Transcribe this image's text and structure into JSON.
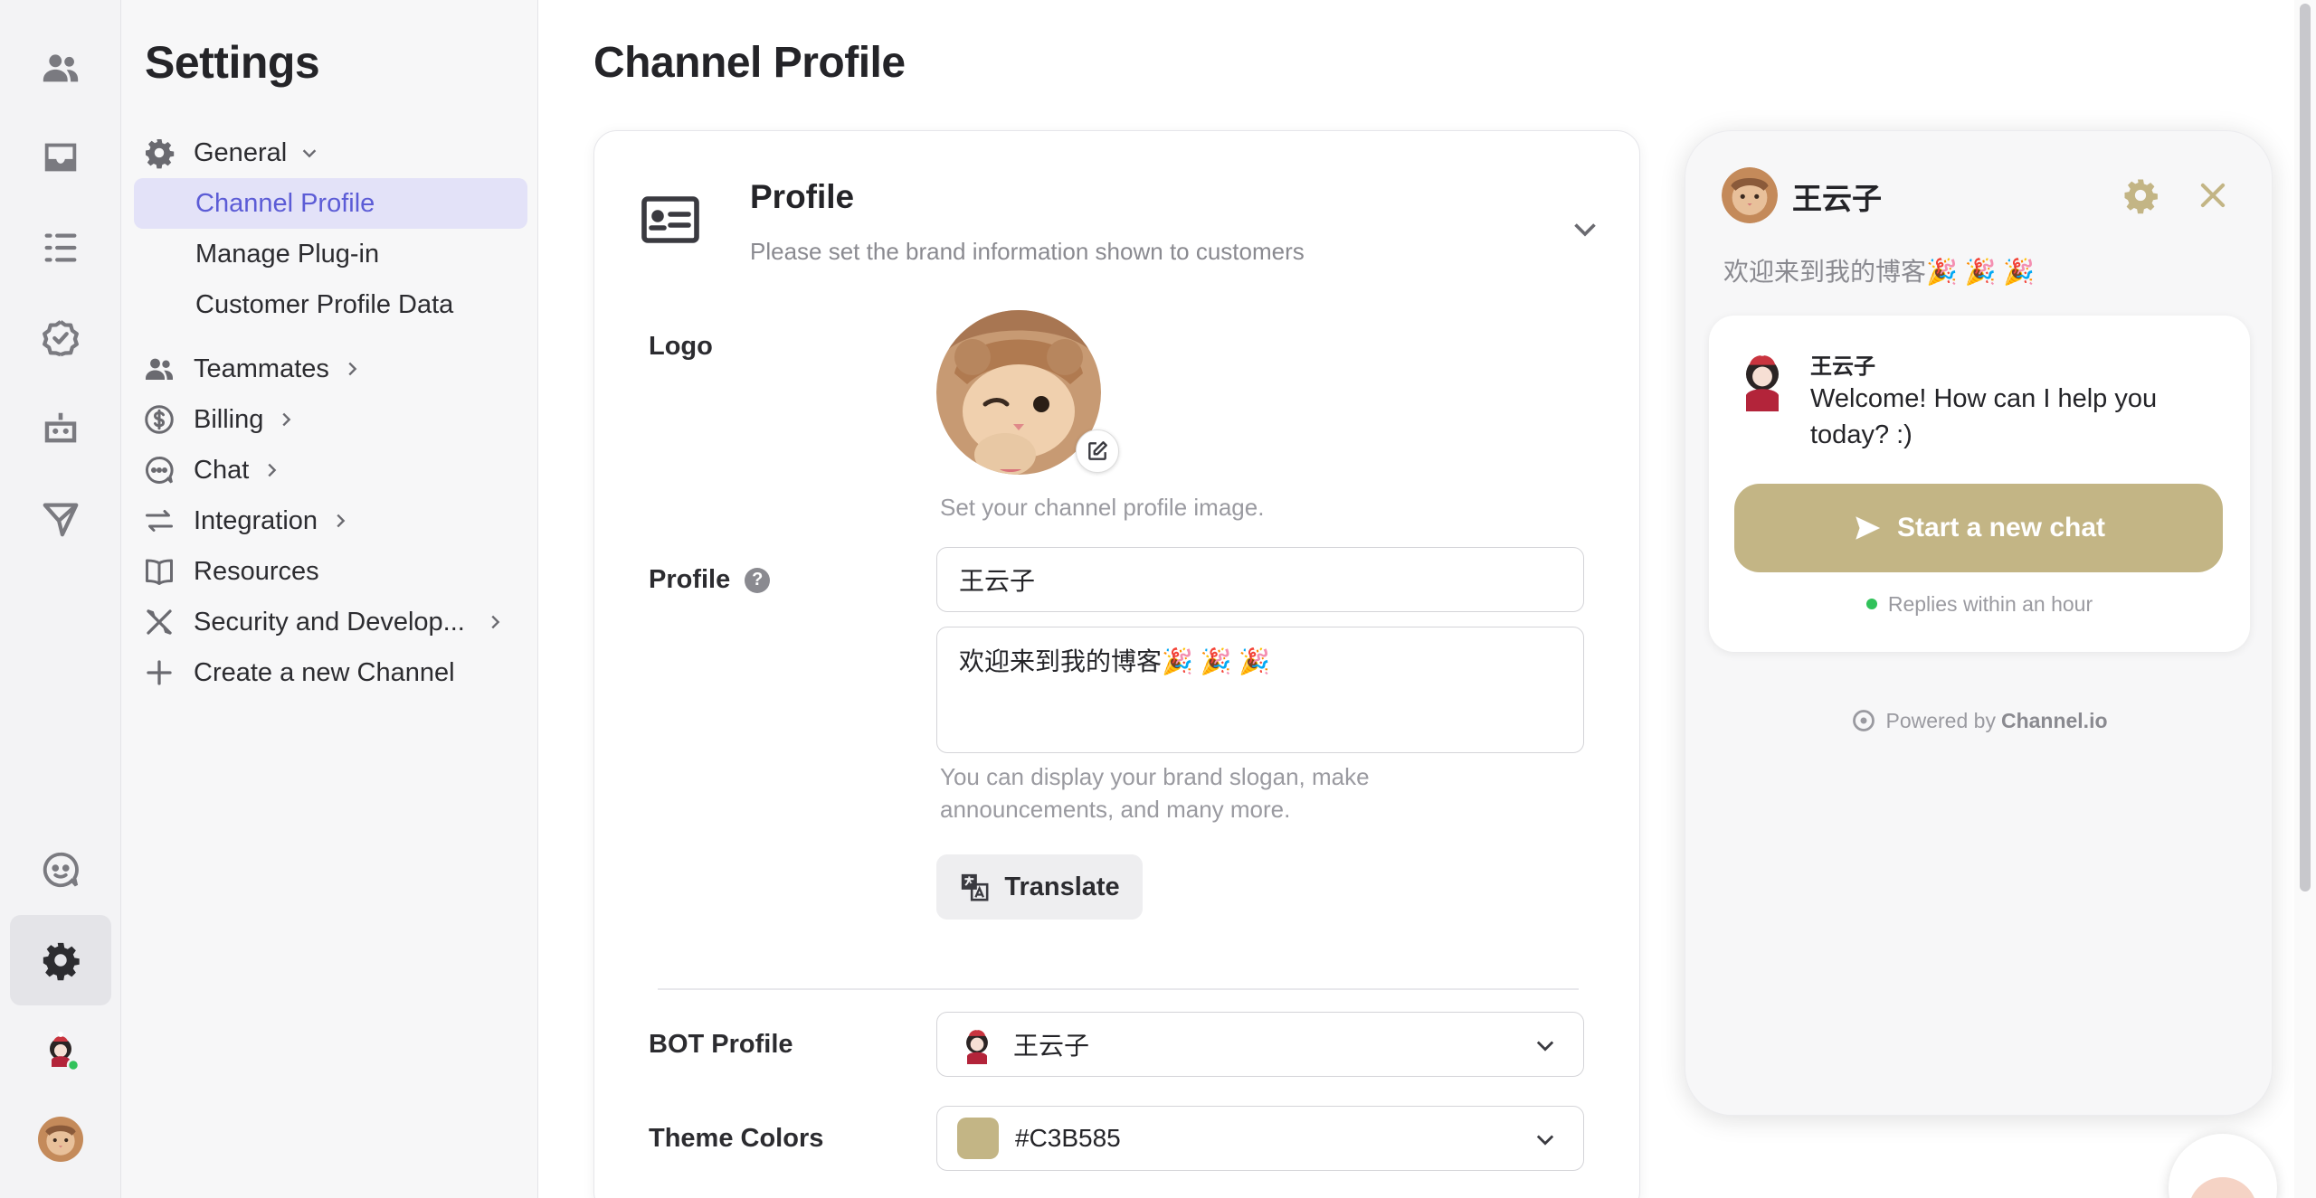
{
  "rail": {
    "items": [
      {
        "icon": "users-icon"
      },
      {
        "icon": "inbox-icon"
      },
      {
        "icon": "list-icon"
      },
      {
        "icon": "badge-check-icon"
      },
      {
        "icon": "bot-icon"
      },
      {
        "icon": "send-icon"
      },
      {
        "icon": "chat-face-icon"
      },
      {
        "icon": "gear-icon",
        "active": true
      }
    ]
  },
  "sidebar": {
    "title": "Settings",
    "items": [
      {
        "label": "General",
        "icon": "gear-icon",
        "expanded": true
      },
      {
        "label": "Channel Profile",
        "active": true
      },
      {
        "label": "Manage Plug-in"
      },
      {
        "label": "Customer Profile Data"
      },
      {
        "label": "Teammates",
        "icon": "users-icon"
      },
      {
        "label": "Billing",
        "icon": "dollar-icon"
      },
      {
        "label": "Chat",
        "icon": "chat-icon"
      },
      {
        "label": "Integration",
        "icon": "arrows-icon"
      },
      {
        "label": "Resources",
        "icon": "book-icon"
      },
      {
        "label": "Security and Develop...",
        "icon": "tools-icon"
      },
      {
        "label": "Create a new Channel",
        "icon": "plus-icon"
      }
    ]
  },
  "main": {
    "title": "Channel Profile",
    "card": {
      "title": "Profile",
      "subtitle": "Please set the brand information shown to customers",
      "logo_label": "Logo",
      "logo_hint": "Set your channel profile image.",
      "profile_label": "Profile",
      "profile_help": "?",
      "profile_name": "王云子",
      "profile_description": "欢迎来到我的博客🎉 🎉 🎉",
      "description_hint_1": "You can display your brand slogan, make",
      "description_hint_2": "announcements, and many more.",
      "translate_label": "Translate",
      "bot_profile_label": "BOT Profile",
      "bot_profile_value": "王云子",
      "theme_colors_label": "Theme Colors",
      "theme_color_value": "#C3B585"
    }
  },
  "preview": {
    "name": "王云子",
    "description": "欢迎来到我的博客🎉 🎉 🎉",
    "bot_name": "王云子",
    "message": "Welcome! How can I help you today? :)",
    "start_button": "Start a new chat",
    "replies": "Replies within an hour",
    "powered_prefix": "Powered by",
    "powered_brand": "Channel.io"
  },
  "colors": {
    "accent": "#5C5CD6",
    "theme": "#C3B585",
    "online": "#31C25A"
  }
}
